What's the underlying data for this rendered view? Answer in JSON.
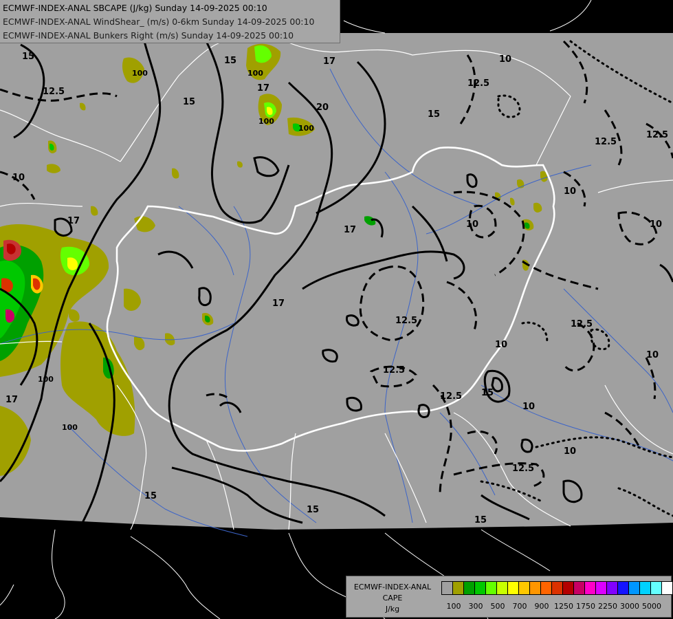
{
  "header": {
    "line1": "ECMWF-INDEX-ANAL SBCAPE (J/kg) Sunday 14-09-2025 00:10",
    "line2": "ECMWF-INDEX-ANAL WindShear_ (m/s) 0-6km Sunday 14-09-2025 00:10",
    "line3": "ECMWF-INDEX-ANAL Bunkers Right (m/s) Sunday 14-09-2025 00:10"
  },
  "legend": {
    "title1": "ECMWF-INDEX-ANAL",
    "title2": "CAPE",
    "unit": "J/kg",
    "colors": [
      "#a0a0a0",
      "#a0a000",
      "#00a000",
      "#00c800",
      "#64ff00",
      "#c8ff00",
      "#ffff00",
      "#ffc800",
      "#ff9600",
      "#ff6400",
      "#dc3200",
      "#b40000",
      "#c80064",
      "#ff00c8",
      "#dc00ff",
      "#8200ff",
      "#1414ff",
      "#0096ff",
      "#00d2ff",
      "#64ffff",
      "#ffffff"
    ],
    "tick_labels": [
      "100",
      "300",
      "500",
      "700",
      "900",
      "1250",
      "1750",
      "2250",
      "3000",
      "5000"
    ]
  },
  "contour_labels": {
    "shear": [
      "15",
      "15",
      "17",
      "17",
      "20",
      "15",
      "15",
      "15",
      "17",
      "17",
      "17",
      "17",
      "15",
      "15",
      "15"
    ],
    "bunkers": [
      "12.5",
      "12.5",
      "10",
      "10",
      "12.5",
      "10",
      "12.5",
      "12.5",
      "12.5",
      "12.5",
      "10",
      "10",
      "10",
      "10",
      "12.5",
      "10",
      "10",
      "12.5"
    ],
    "cape": [
      "100",
      "100",
      "100",
      "100",
      "100",
      "100"
    ]
  }
}
